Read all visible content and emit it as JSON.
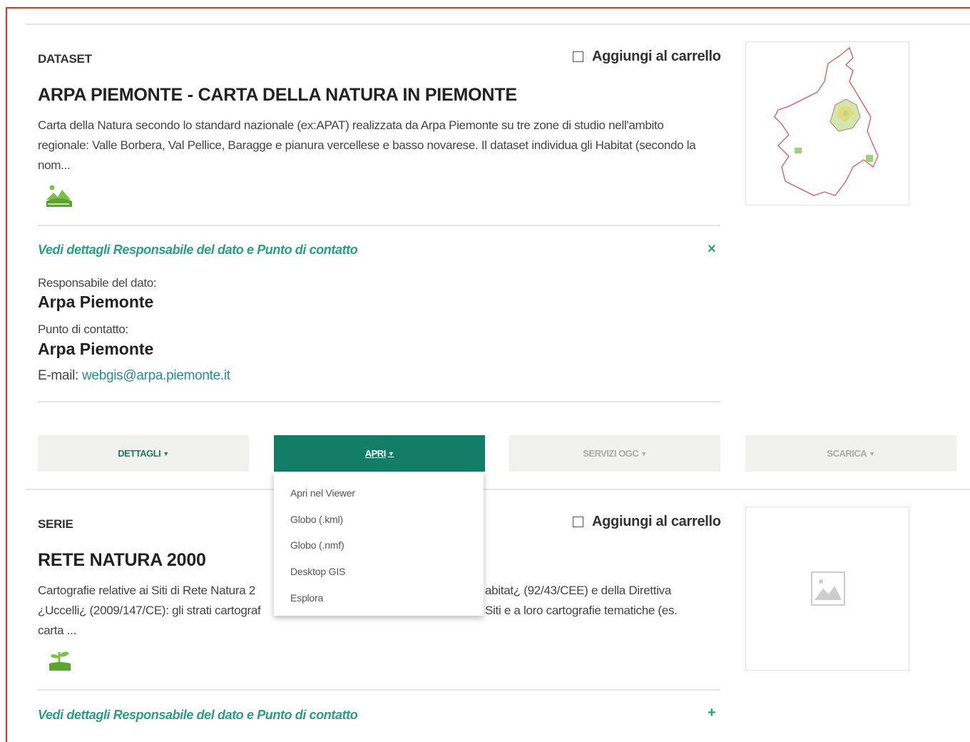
{
  "dataset1": {
    "type_label": "DATASET",
    "cart_label": "Aggiungi al carrello",
    "title": "ARPA PIEMONTE - CARTA DELLA NATURA IN PIEMONTE",
    "description": "Carta della Natura secondo lo standard nazionale (ex:APAT) realizzata da Arpa Piemonte su tre zone di studio nell'ambito regionale: Valle Borbera, Val Pellice, Baragge e pianura vercellese e basso novarese. Il dataset individua gli Habitat (secondo la nom...",
    "theme_icon": "landscape-theme-icon",
    "details_link": "Vedi dettagli Responsabile del dato e Punto di contatto",
    "details_toggle": "×",
    "responsible_label": "Responsabile del dato:",
    "responsible_name": "Arpa Piemonte",
    "contact_label": "Punto di contatto:",
    "contact_name": "Arpa Piemonte",
    "email_label": "E-mail: ",
    "email": "webgis@arpa.piemonte.it"
  },
  "actions": {
    "dettagli": "DETTAGLI",
    "apri": "APRI",
    "servizi": "SERVIZI OGC",
    "scarica": "SCARICA"
  },
  "apri_menu": [
    "Apri nel Viewer",
    "Globo (.kml)",
    "Globo (.nmf)",
    "Desktop GIS",
    "Esplora"
  ],
  "dataset2": {
    "type_label": "SERIE",
    "cart_label": "Aggiungi al carrello",
    "title": "RETE NATURA 2000",
    "description_line1_left": "Cartografie relative ai Siti di Rete Natura 2",
    "description_line1_right": "abitat¿ (92/43/CEE) e della Direttiva",
    "description_line2_left": "¿Uccelli¿ (2009/147/CE): gli strati cartograf",
    "description_line2_right": "Siti e a loro cartografie tematiche (es.",
    "description_line3": "carta ...",
    "theme_icon": "plant-theme-icon",
    "details_link": "Vedi dettagli Responsabile del dato e Punto di contatto",
    "details_toggle": "+"
  },
  "colors": {
    "accent_green": "#147d68",
    "link_green": "#2a9d83",
    "frame_red": "#d9302c"
  }
}
